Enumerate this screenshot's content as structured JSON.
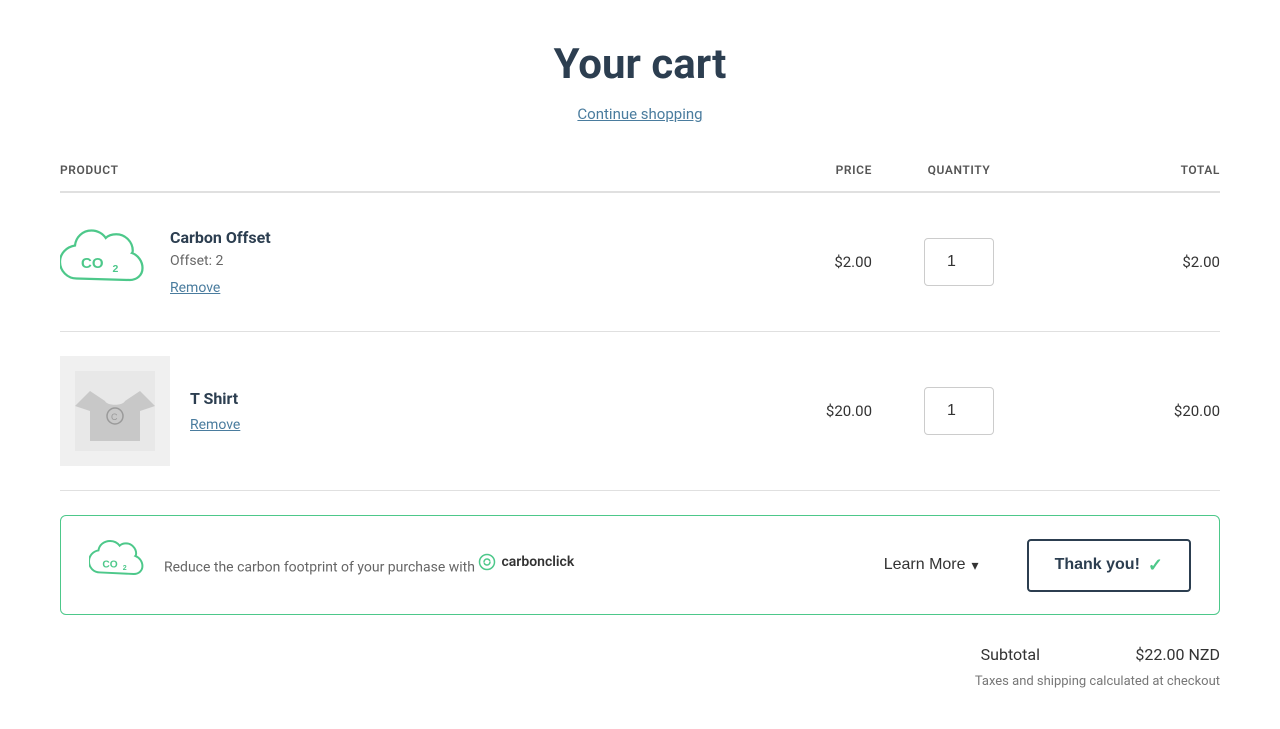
{
  "page": {
    "title": "Your cart",
    "continue_shopping": "Continue shopping"
  },
  "table": {
    "headers": {
      "product": "PRODUCT",
      "price": "PRICE",
      "quantity": "QUANTITY",
      "total": "TOTAL"
    }
  },
  "items": [
    {
      "id": "carbon-offset",
      "name": "Carbon Offset",
      "detail": "Offset: 2",
      "remove_label": "Remove",
      "price": "$2.00",
      "quantity": "1",
      "total": "$2.00",
      "image_type": "co2"
    },
    {
      "id": "t-shirt",
      "name": "T Shirt",
      "detail": "",
      "remove_label": "Remove",
      "price": "$20.00",
      "quantity": "1",
      "total": "$20.00",
      "image_type": "tshirt"
    }
  ],
  "banner": {
    "text_before": "Reduce the carbon footprint of your purchase with",
    "brand_name": "carbonclick",
    "learn_more": "Learn More",
    "thank_you": "Thank you!"
  },
  "summary": {
    "subtotal_label": "Subtotal",
    "subtotal_value": "$22.00 NZD",
    "tax_note": "Taxes and shipping calculated at checkout"
  }
}
